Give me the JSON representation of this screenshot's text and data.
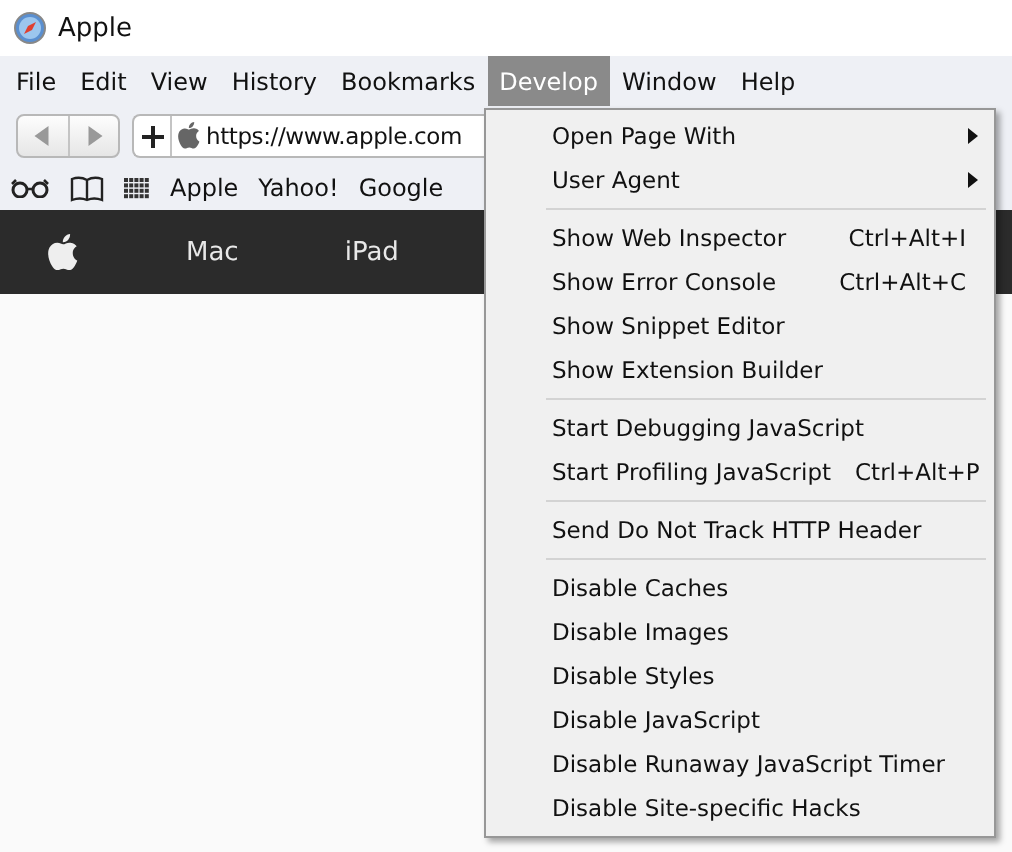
{
  "window": {
    "title": "Apple"
  },
  "menu_bar": [
    {
      "label": "File",
      "selected": false
    },
    {
      "label": "Edit",
      "selected": false
    },
    {
      "label": "View",
      "selected": false
    },
    {
      "label": "History",
      "selected": false
    },
    {
      "label": "Bookmarks",
      "selected": false
    },
    {
      "label": "Develop",
      "selected": true
    },
    {
      "label": "Window",
      "selected": false
    },
    {
      "label": "Help",
      "selected": false
    }
  ],
  "address_bar": {
    "url": "https://www.apple.com"
  },
  "bookmarks": [
    "Apple",
    "Yahoo!",
    "Google"
  ],
  "site_nav": [
    "Mac",
    "iPad"
  ],
  "develop_menu": [
    [
      {
        "kind": "submenu",
        "label": "Open Page With"
      },
      {
        "kind": "submenu",
        "label": "User Agent"
      }
    ],
    [
      {
        "kind": "command",
        "label": "Show Web Inspector",
        "shortcut": "Ctrl+Alt+I"
      },
      {
        "kind": "command",
        "label": "Show Error Console",
        "shortcut": "Ctrl+Alt+C"
      },
      {
        "kind": "command",
        "label": "Show Snippet Editor"
      },
      {
        "kind": "command",
        "label": "Show Extension Builder"
      }
    ],
    [
      {
        "kind": "command",
        "label": "Start Debugging JavaScript"
      },
      {
        "kind": "command",
        "label": "Start Profiling JavaScript",
        "shortcut": "Ctrl+Alt+P"
      }
    ],
    [
      {
        "kind": "command",
        "label": "Send Do Not Track HTTP Header"
      }
    ],
    [
      {
        "kind": "command",
        "label": "Disable Caches"
      },
      {
        "kind": "command",
        "label": "Disable Images"
      },
      {
        "kind": "command",
        "label": "Disable Styles"
      },
      {
        "kind": "command",
        "label": "Disable JavaScript"
      },
      {
        "kind": "command",
        "label": "Disable Runaway JavaScript Timer"
      },
      {
        "kind": "command",
        "label": "Disable Site-specific Hacks"
      }
    ]
  ]
}
